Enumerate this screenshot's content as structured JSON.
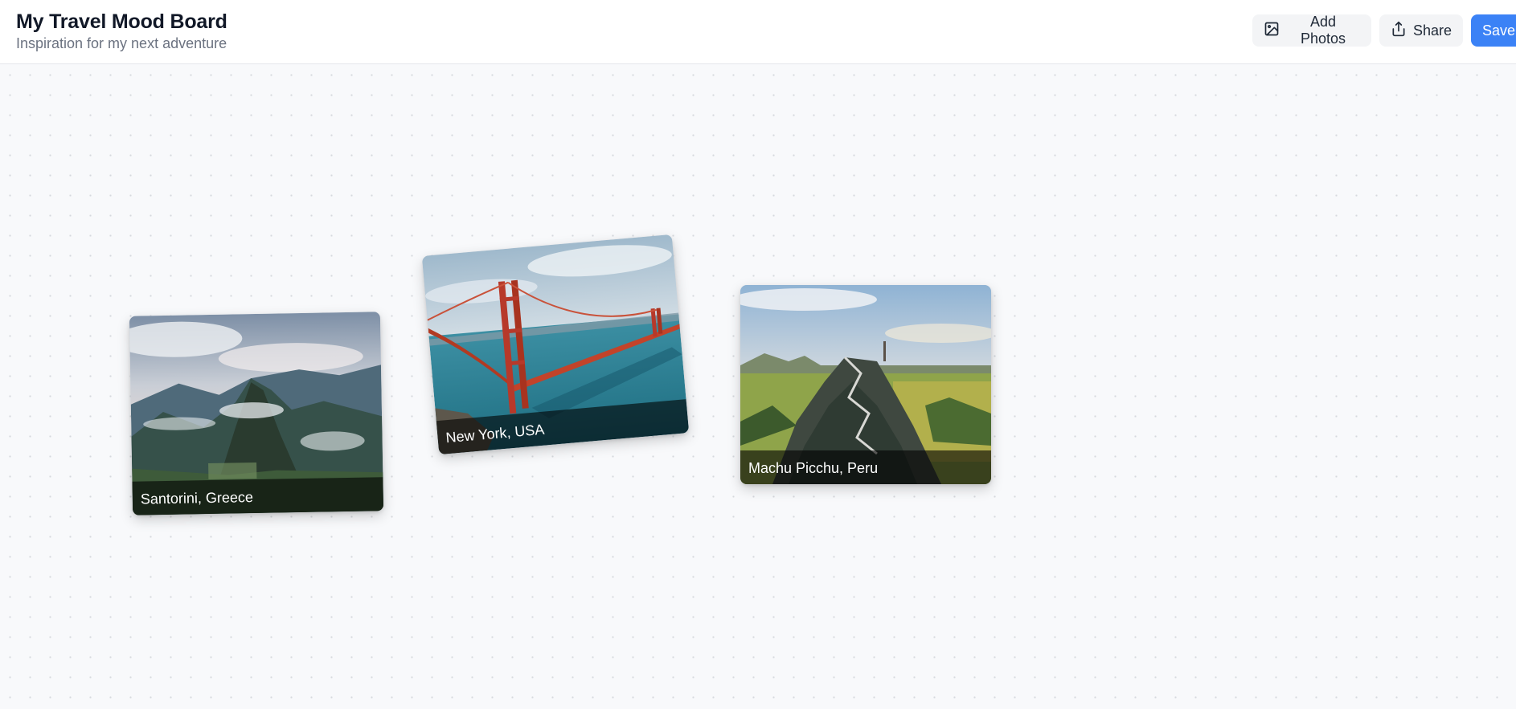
{
  "header": {
    "title": "My Travel Mood Board",
    "subtitle": "Inspiration for my next adventure"
  },
  "toolbar": {
    "add_photos_label": "Add Photos",
    "add_photos_icon": "image-icon",
    "share_label": "Share",
    "share_icon": "share-icon",
    "save_label": "Save"
  },
  "board": {
    "cards": [
      {
        "caption": "Santorini, Greece",
        "rotation_deg": -1
      },
      {
        "caption": "New York, USA",
        "rotation_deg": -5
      },
      {
        "caption": "Machu Picchu, Peru",
        "rotation_deg": 0
      }
    ]
  },
  "colors": {
    "accent": "#3b82f6",
    "board_background": "#f8f9fb",
    "dot_grid": "#d6d9de",
    "button_background": "#f3f4f6"
  }
}
